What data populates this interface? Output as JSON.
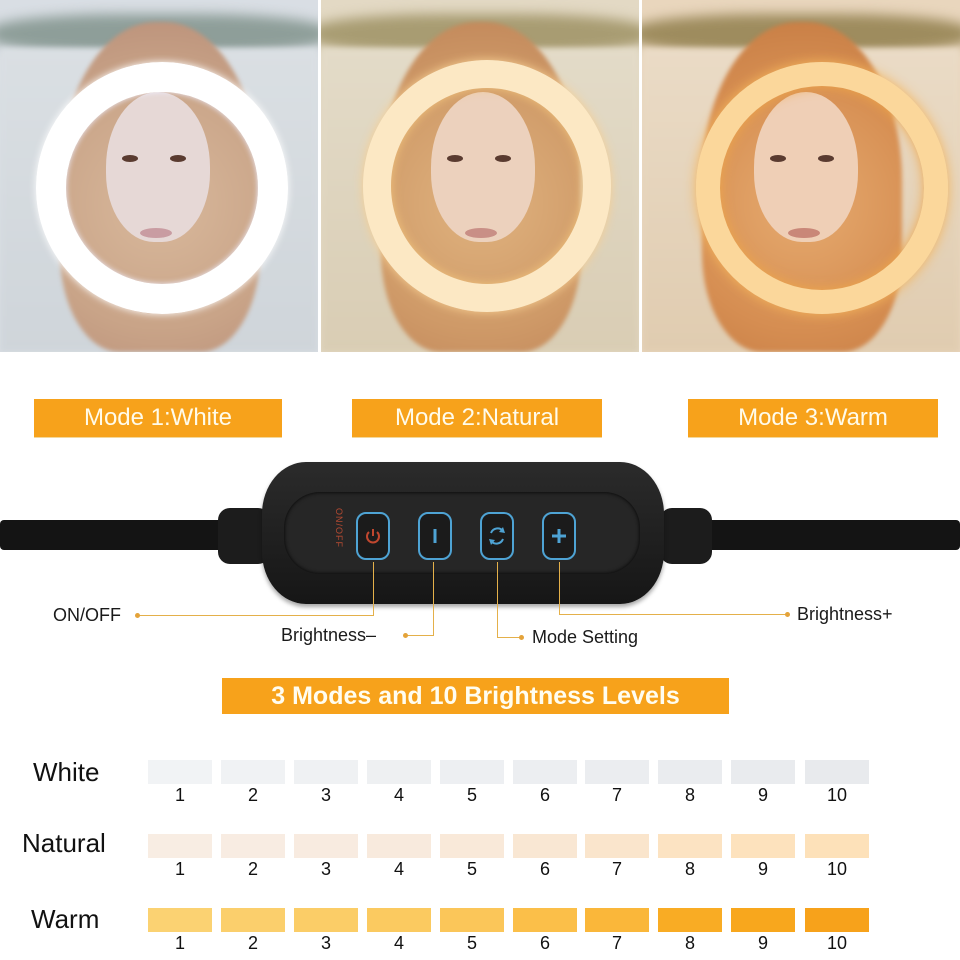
{
  "panels": [
    {
      "mode": "white",
      "ring_color": "#ffffff",
      "tint": "#dfe6ee"
    },
    {
      "mode": "natural",
      "ring_color": "#fbe3b8",
      "tint": "#e8dcc2"
    },
    {
      "mode": "warm",
      "ring_color": "#f7c56e",
      "tint": "#ecd7b8"
    }
  ],
  "mode_labels": [
    "Mode 1:White",
    "Mode 2:Natural",
    "Mode 3:Warm"
  ],
  "controller": {
    "side_text": "ON/OFF",
    "buttons": [
      {
        "icon": "power-icon",
        "label": "ON/OFF"
      },
      {
        "icon": "minus-icon",
        "label": "Brightness–"
      },
      {
        "icon": "cycle-icon",
        "label": "Mode Setting"
      },
      {
        "icon": "plus-icon",
        "label": "Brightness+"
      }
    ]
  },
  "callouts": {
    "on_off": "ON/OFF",
    "brightness_minus": "Brightness–",
    "mode_setting": "Mode Setting",
    "brightness_plus": "Brightness+"
  },
  "heading": "3 Modes and 10  Brightness Levels",
  "levels": [
    "1",
    "2",
    "3",
    "4",
    "5",
    "6",
    "7",
    "8",
    "9",
    "10"
  ],
  "rows": [
    {
      "label": "White",
      "colors": [
        "#f1f3f5",
        "#f0f2f4",
        "#eff1f3",
        "#eef0f2",
        "#edeff2",
        "#eceef1",
        "#ebedf0",
        "#eaecef",
        "#e9ebee",
        "#e8eaed"
      ]
    },
    {
      "label": "Natural",
      "colors": [
        "#f8ede3",
        "#f8ece2",
        "#f8ebe0",
        "#f8eadd",
        "#f9e9d9",
        "#f9e7d3",
        "#faE5cc",
        "#fce3c2",
        "#fde2bd",
        "#fde1b9"
      ]
    },
    {
      "label": "Warm",
      "colors": [
        "#fbd272",
        "#fbcf6c",
        "#fbcd67",
        "#fbca60",
        "#fbc659",
        "#fbbf49",
        "#fab73a",
        "#f9ac24",
        "#f8a71d",
        "#f7a21b"
      ]
    }
  ],
  "colors": {
    "accent_orange": "#f7a21b",
    "button_outline": "#4ea3d4",
    "leader_line": "#e4b04a"
  }
}
